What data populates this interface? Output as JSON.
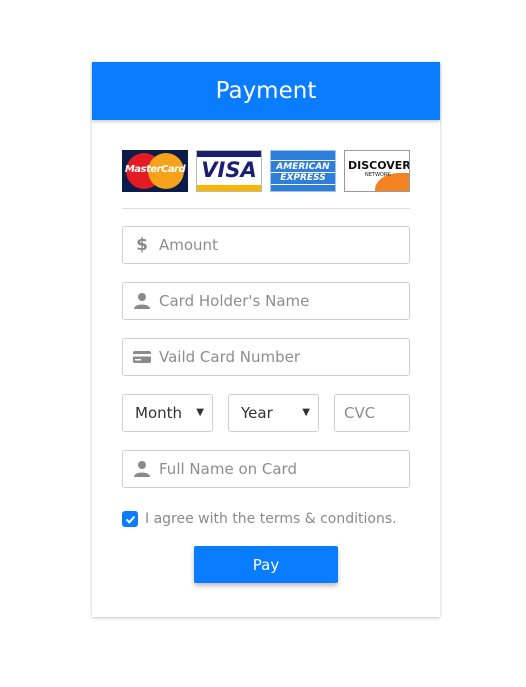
{
  "header": {
    "title": "Payment"
  },
  "card_logos": {
    "mastercard": {
      "icon": "mastercard-logo",
      "text": "MasterCard"
    },
    "visa": {
      "icon": "visa-logo",
      "text": "VISA"
    },
    "amex": {
      "icon": "american-express-logo",
      "line1": "AMERICAN",
      "line2": "EXPRESS"
    },
    "discover": {
      "icon": "discover-logo",
      "text": "DISCOVER",
      "sub": "NETWORK"
    }
  },
  "form": {
    "amount": {
      "icon": "dollar-icon",
      "placeholder": "Amount",
      "value": ""
    },
    "card_holder": {
      "icon": "user-icon",
      "placeholder": "Card Holder's Name",
      "value": ""
    },
    "card_number": {
      "icon": "credit-card-icon",
      "placeholder": "Vaild Card Number",
      "value": ""
    },
    "month": {
      "selected": "Month"
    },
    "year": {
      "selected": "Year"
    },
    "cvc": {
      "placeholder": "CVC",
      "value": ""
    },
    "full_name": {
      "icon": "user-icon",
      "placeholder": "Full Name on Card",
      "value": ""
    }
  },
  "terms": {
    "checked": true,
    "label": "I agree with the terms & conditions."
  },
  "pay_button": {
    "label": "Pay"
  },
  "colors": {
    "accent": "#0a7cff",
    "border": "#cfcfcf",
    "muted_text": "#8a8a8a"
  }
}
